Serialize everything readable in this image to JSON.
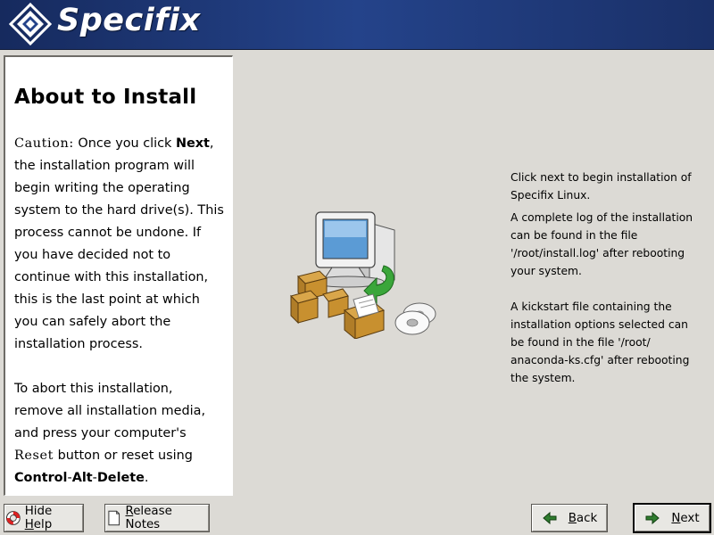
{
  "header": {
    "brand": "Specifix",
    "logo_icon": "diamond-logo-icon",
    "colors": {
      "banner": "#1c3570",
      "panel_bg": "#dcdad5"
    }
  },
  "help": {
    "title": "About to Install",
    "p1": {
      "caution_word": "Caution:",
      "text1": " Once you click ",
      "next_word": "Next",
      "text2": ", the installation program will begin writing the operating system to the hard drive(s). This process cannot be undone. If you have decided not to continue with this installation, this is the last point at which you can safely abort the installation process."
    },
    "p2": {
      "text1": "To abort this installation, remove all installation media, and press your computer's ",
      "reset_word": "Reset",
      "text2": " button or reset using ",
      "control": "Control",
      "dash1": "-",
      "alt": "Alt",
      "dash2": "-",
      "delete": "Delete",
      "end": "."
    }
  },
  "illustration": {
    "icon": "computer-install-packages-icon"
  },
  "info": {
    "p1": "Click next to begin installation of Specifix Linux.",
    "p2": "A complete log of the installation can be found in the file '/root/install.log' after rebooting your system.",
    "p3": "A kickstart file containing the installation options selected can be found in the file '/root/ anaconda-ks.cfg' after rebooting the system."
  },
  "buttons": {
    "hide_help": {
      "pre": "Hide ",
      "underlined": "H",
      "post": "elp",
      "icon": "lifebuoy-icon"
    },
    "release_notes": {
      "pre": "",
      "underlined": "R",
      "post": "elease Notes",
      "icon": "document-icon"
    },
    "back": {
      "pre": "",
      "underlined": "B",
      "post": "ack",
      "icon": "arrow-left-icon"
    },
    "next": {
      "pre": "",
      "underlined": "N",
      "post": "ext",
      "icon": "arrow-right-icon"
    }
  }
}
